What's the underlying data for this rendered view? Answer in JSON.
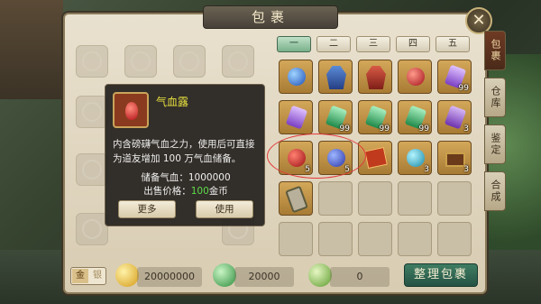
{
  "window": {
    "title": "包裹"
  },
  "tabs": [
    "一",
    "二",
    "三",
    "四",
    "五"
  ],
  "active_tab_index": 0,
  "side_tabs": [
    "包裹",
    "仓库",
    "鉴定",
    "合成"
  ],
  "active_side_tab_index": 0,
  "tooltip": {
    "item_name": "气血露",
    "description": "内含磅礴气血之力，使用后可直接为道友增加 100 万气血储备。",
    "stat_label": "储备气血：",
    "stat_value": "1000000",
    "price_label": "出售价格：",
    "price_value": "100",
    "price_unit": "金币",
    "more_button": "更多",
    "use_button": "使用"
  },
  "inventory": [
    {
      "icon": "blue-orb-icon",
      "count": ""
    },
    {
      "icon": "blue-robe-icon",
      "count": ""
    },
    {
      "icon": "red-robe-icon",
      "count": ""
    },
    {
      "icon": "red-orb-icon",
      "count": ""
    },
    {
      "icon": "purple-crystal-icon",
      "count": "99"
    },
    {
      "icon": "purple-crystal-icon",
      "count": ""
    },
    {
      "icon": "green-gem-icon",
      "count": "99"
    },
    {
      "icon": "green-gem-icon",
      "count": "99"
    },
    {
      "icon": "green-gem-icon",
      "count": "99"
    },
    {
      "icon": "purple-gem-icon",
      "count": "3"
    },
    {
      "icon": "red-potion-icon",
      "count": "5"
    },
    {
      "icon": "blue-potion-icon",
      "count": "5"
    },
    {
      "icon": "red-book-icon",
      "count": ""
    },
    {
      "icon": "cyan-orb-icon",
      "count": "3"
    },
    {
      "icon": "treasure-box-icon",
      "count": "3"
    },
    {
      "icon": "scroll-icon",
      "count": ""
    }
  ],
  "bottom_bar": {
    "bind_labels": [
      "金",
      "银"
    ],
    "gold": "20000000",
    "jade": "20000",
    "gourd": "0",
    "organize_button": "整理包裹"
  },
  "colors": {
    "active_tab": "#79b08a",
    "organize_button": "#3f7d63",
    "tooltip_name": "#e8e13e",
    "highlight_ring": "#e33b3b"
  }
}
